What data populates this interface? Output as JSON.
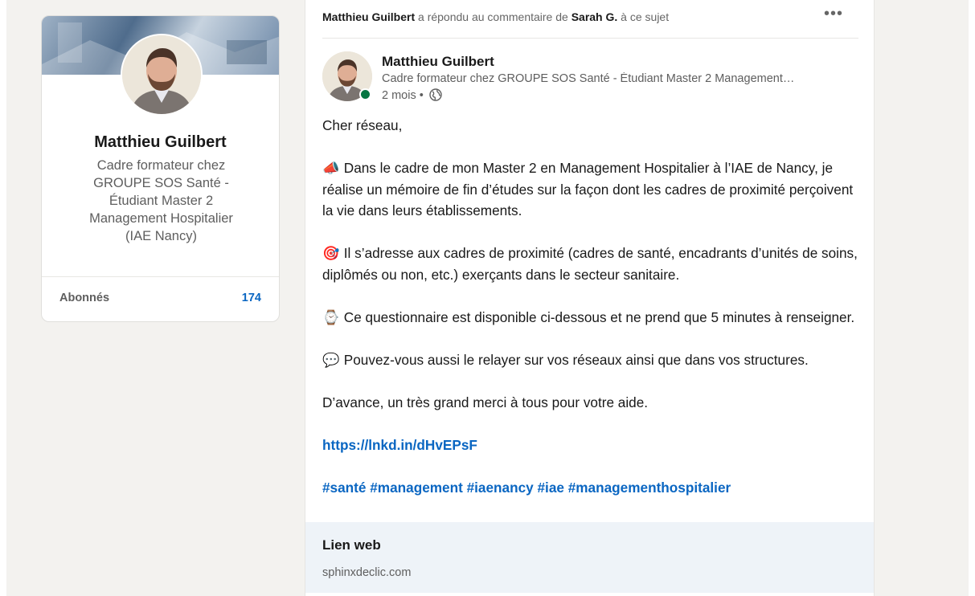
{
  "profile": {
    "name": "Matthieu Guilbert",
    "headline_lines": [
      "Cadre formateur chez",
      "GROUPE SOS Santé -",
      "Étudiant Master 2",
      "Management Hospitalier",
      "(IAE Nancy)"
    ],
    "followers_label": "Abonnés",
    "followers_count": "174"
  },
  "post": {
    "activity": {
      "actor": "Matthieu Guilbert",
      "action": " a répondu au commentaire de ",
      "target": "Sarah G.",
      "suffix": " à ce sujet"
    },
    "more_label": "•••",
    "author": {
      "name": "Matthieu Guilbert",
      "headline": "Cadre formateur chez GROUPE SOS Santé - Étudiant Master 2 Management…",
      "time": "2 mois •"
    },
    "body": {
      "greeting": "Cher réseau,",
      "p1_emoji": "📣",
      "p1_text": "Dans le cadre de mon Master 2 en Management Hospitalier à l’IAE de Nancy, je réalise un mémoire de fin d’études sur la façon dont les cadres de proximité perçoivent la vie dans leurs établissements.",
      "p2_emoji": "🎯",
      "p2_text": "Il s’adresse aux cadres de proximité (cadres de santé, encadrants d’unités de soins, diplômés ou non, etc.) exerçants dans le secteur sanitaire.",
      "p3_emoji": "⌚",
      "p3_text": "Ce questionnaire est disponible ci-dessous et ne prend que 5 minutes à renseigner.",
      "p4_emoji": "💬",
      "p4_text": "Pouvez-vous aussi le relayer sur vos réseaux ainsi que dans vos structures.",
      "thanks": "D’avance, un très grand merci à tous pour votre aide.",
      "url": "https://lnkd.in/dHvEPsF",
      "hashtags": "#santé #management #iaenancy #iae #managementhospitalier"
    },
    "web_link": {
      "title": "Lien web",
      "domain": "sphinxdeclic.com"
    }
  },
  "colors": {
    "accent_blue": "#0a66c2",
    "online_green": "#057642",
    "page_bg": "#f3f2ef",
    "link_box_bg": "#eef3f8"
  }
}
